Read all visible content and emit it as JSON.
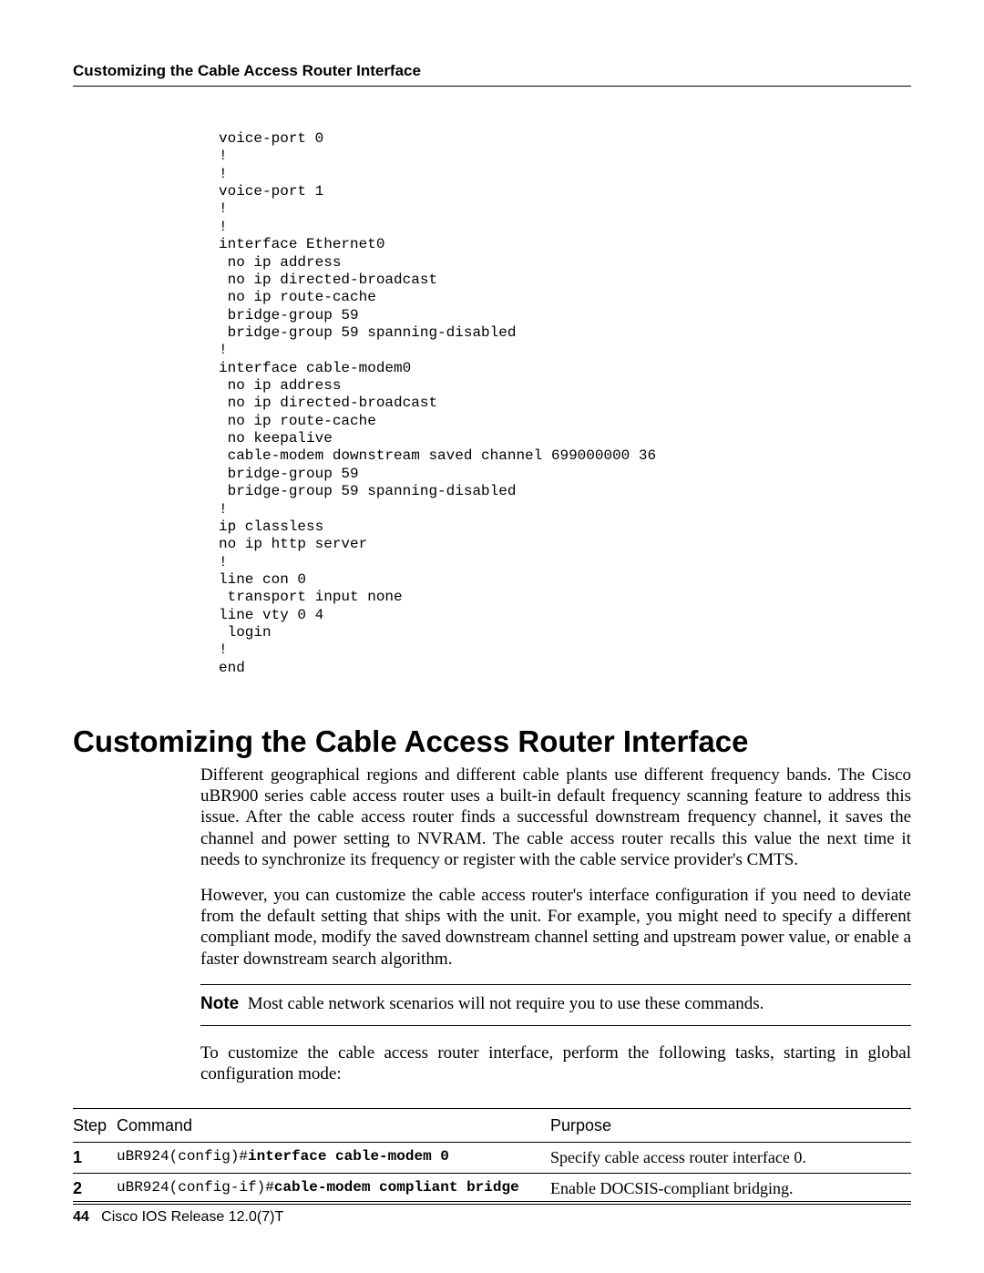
{
  "header": {
    "running_title": "Customizing the Cable Access Router Interface"
  },
  "code": "voice-port 0\n!\n!\nvoice-port 1\n!\n!\ninterface Ethernet0\n no ip address\n no ip directed-broadcast\n no ip route-cache\n bridge-group 59\n bridge-group 59 spanning-disabled\n!\ninterface cable-modem0\n no ip address\n no ip directed-broadcast\n no ip route-cache\n no keepalive\n cable-modem downstream saved channel 699000000 36\n bridge-group 59\n bridge-group 59 spanning-disabled\n!\nip classless\nno ip http server\n!\nline con 0\n transport input none\nline vty 0 4\n login\n!\nend",
  "section": {
    "heading": "Customizing the Cable Access Router Interface",
    "p1": "Different geographical regions and different cable plants use different frequency bands. The Cisco uBR900 series cable access router uses a built-in default frequency scanning feature to address this issue. After the cable access router finds a successful downstream frequency channel, it saves the channel and power setting to NVRAM. The cable access router recalls this value the next time it needs to synchronize its frequency or register with the cable service provider's CMTS.",
    "p2": "However, you can customize the cable access router's interface configuration if you need to deviate from the default setting that ships with the unit. For example, you might need to specify a different compliant mode, modify the saved downstream channel setting and upstream power value, or enable a faster downstream search algorithm.",
    "note_label": "Note",
    "note_text": "Most cable network scenarios will not require you to use these commands.",
    "p3": "To customize the cable access router interface, perform the following tasks, starting in global configuration mode:"
  },
  "table": {
    "headers": {
      "step": "Step",
      "command": "Command",
      "purpose": "Purpose"
    },
    "rows": [
      {
        "num": "1",
        "prompt": "uBR924(config)#",
        "cmd": "interface cable-modem 0",
        "purpose": "Specify cable access router interface 0."
      },
      {
        "num": "2",
        "prompt": "uBR924(config-if)#",
        "cmd": "cable-modem compliant bridge",
        "purpose": "Enable DOCSIS-compliant bridging."
      }
    ]
  },
  "footer": {
    "page": "44",
    "release": "Cisco IOS Release 12.0(7)T"
  }
}
